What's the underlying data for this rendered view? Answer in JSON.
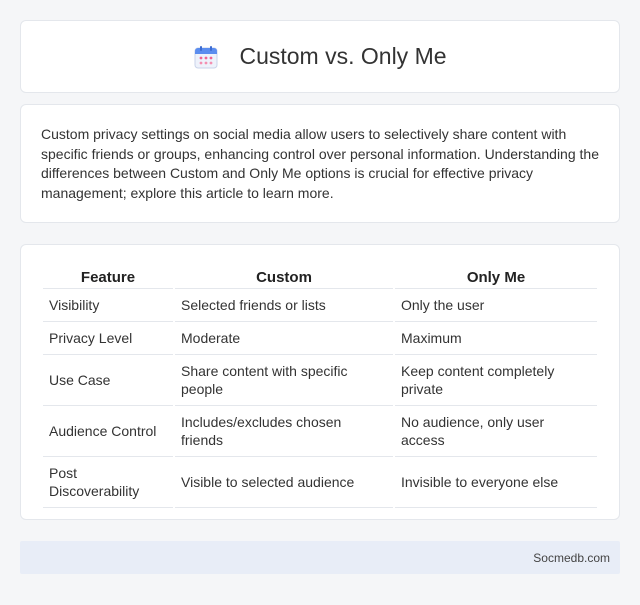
{
  "header": {
    "title": "Custom vs. Only Me",
    "icon": "calendar-icon"
  },
  "intro": {
    "text": "Custom privacy settings on social media allow users to selectively share content with specific friends or groups, enhancing control over personal information. Understanding the differences between Custom and Only Me options is crucial for effective privacy management; explore this article to learn more."
  },
  "table": {
    "headers": [
      "Feature",
      "Custom",
      "Only Me"
    ],
    "rows": [
      [
        "Visibility",
        "Selected friends or lists",
        "Only the user"
      ],
      [
        "Privacy Level",
        "Moderate",
        "Maximum"
      ],
      [
        "Use Case",
        "Share content with specific people",
        "Keep content completely private"
      ],
      [
        "Audience Control",
        "Includes/excludes chosen friends",
        "No audience, only user access"
      ],
      [
        "Post Discoverability",
        "Visible to selected audience",
        "Invisible to everyone else"
      ]
    ]
  },
  "footer": {
    "site": "Socmedb.com"
  },
  "colors": {
    "background": "#f5f6f8",
    "footer_bg": "#e8edf7",
    "icon_blue": "#5b8def",
    "icon_pink": "#f06292"
  }
}
